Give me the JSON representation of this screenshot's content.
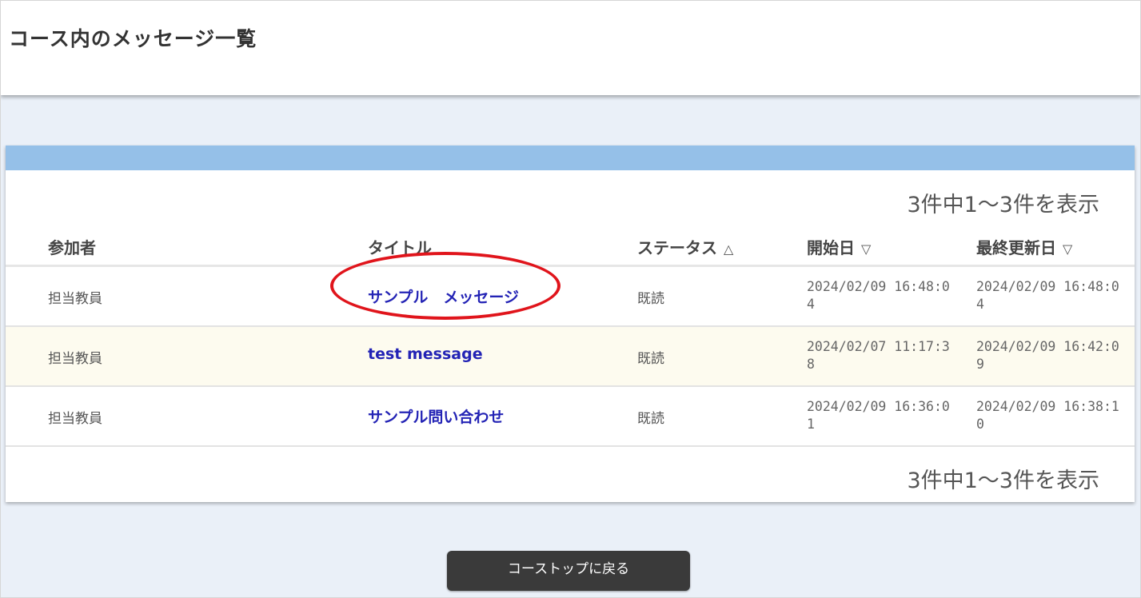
{
  "page": {
    "title": "コース内のメッセージ一覧"
  },
  "pagination": {
    "top_text": "3件中1～3件を表示",
    "bottom_text": "3件中1～3件を表示"
  },
  "table": {
    "columns": [
      {
        "label": "参加者",
        "sort_icon": ""
      },
      {
        "label": "タイトル",
        "sort_icon": ""
      },
      {
        "label": "ステータス",
        "sort_icon": "△"
      },
      {
        "label": "開始日",
        "sort_icon": "▽"
      },
      {
        "label": "最終更新日",
        "sort_icon": "▽"
      }
    ],
    "rows": [
      {
        "participant": "担当教員",
        "title": "サンプル　メッセージ",
        "status": "既読",
        "start_date": "2024/02/09 16:48:04",
        "updated_date": "2024/02/09 16:48:04",
        "highlighted": true
      },
      {
        "participant": "担当教員",
        "title": "test message",
        "status": "既読",
        "start_date": "2024/02/07 11:17:38",
        "updated_date": "2024/02/09 16:42:09",
        "highlighted": false
      },
      {
        "participant": "担当教員",
        "title": "サンプル問い合わせ",
        "status": "既読",
        "start_date": "2024/02/09 16:36:01",
        "updated_date": "2024/02/09 16:38:10",
        "highlighted": false
      }
    ]
  },
  "footer": {
    "back_button_label": "コーストップに戻る"
  },
  "colors": {
    "panel_bar": "#95c0e8",
    "link": "#2323b5",
    "alt_row": "#fdfbef",
    "highlight_circle": "#e0141b",
    "button_bg": "#3a3a3a"
  }
}
